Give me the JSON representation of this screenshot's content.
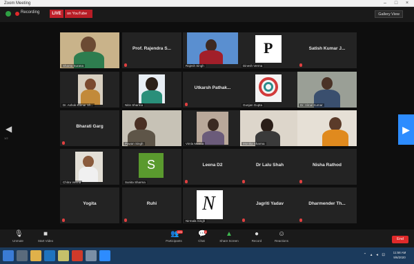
{
  "window": {
    "title": "Zoom Meeting"
  },
  "topbar": {
    "recording_label": "Recording",
    "live_label": "LIVE",
    "stream_label": "on YouTube",
    "view_label": "Gallery View"
  },
  "grid": {
    "tiles": [
      {
        "name": "",
        "label": "Shanta Surana",
        "type": "photo"
      },
      {
        "name": "Prof. Rajendra S...",
        "label": "",
        "type": "name"
      },
      {
        "name": "",
        "label": "Rajesh Singh",
        "type": "photo"
      },
      {
        "name": "",
        "label": "Dinesh Verma",
        "type": "logo-p"
      },
      {
        "name": "Satish Kumar J...",
        "label": "",
        "type": "name"
      },
      {
        "name": "",
        "label": "Dr. Ashok Kumar Sh...",
        "type": "photo"
      },
      {
        "name": "",
        "label": "Nitin Sharma",
        "type": "photo"
      },
      {
        "name": "Utkarsh Pathak...",
        "label": "",
        "type": "name"
      },
      {
        "name": "",
        "label": "Gunjan Gupta",
        "type": "logo-circle"
      },
      {
        "name": "",
        "label": "Dr. Vimal Kumar",
        "type": "photo"
      },
      {
        "name": "Bharati Garg",
        "label": "",
        "type": "name"
      },
      {
        "name": "",
        "label": "Pawan Singh",
        "type": "photo"
      },
      {
        "name": "",
        "label": "Vimla Meena",
        "type": "photo"
      },
      {
        "name": "",
        "label": "Monika Sharma",
        "type": "photo"
      },
      {
        "name": "",
        "label": "",
        "type": "photo"
      },
      {
        "name": "",
        "label": "Chitra Verma",
        "type": "photo"
      },
      {
        "name": "",
        "label": "Sunita Sharma",
        "type": "avatar-s"
      },
      {
        "name": "Leena D2",
        "label": "",
        "type": "name"
      },
      {
        "name": "Dr Lalu Shah",
        "label": "",
        "type": "name"
      },
      {
        "name": "Nisha Rathod",
        "label": "",
        "type": "name"
      },
      {
        "name": "Yogita",
        "label": "",
        "type": "name"
      },
      {
        "name": "Ruhi",
        "label": "",
        "type": "name"
      },
      {
        "name": "",
        "label": "Nirmala Singh",
        "type": "logo-n"
      },
      {
        "name": "Jagriti Yadav",
        "label": "",
        "type": "name"
      },
      {
        "name": "Dharmender Th...",
        "label": "",
        "type": "name"
      }
    ]
  },
  "navigation": {
    "prev_label": "1/2"
  },
  "toolbar": {
    "mute": "Unmute",
    "video": "Start Video",
    "participants": "Participants",
    "participants_count": "225",
    "chat": "Chat",
    "chat_badge": "4",
    "share": "Share Screen",
    "record": "Record",
    "reactions": "Reactions",
    "end": "End"
  },
  "taskbar": {
    "tray_icons": "⌃ ▴ ◂ ⊡",
    "time": "11:58 AM",
    "date": "9/6/2020"
  },
  "colors": {
    "accent_blue": "#2d8cff",
    "end_red": "#e02a2a",
    "active_speaker": "#f5c342"
  }
}
